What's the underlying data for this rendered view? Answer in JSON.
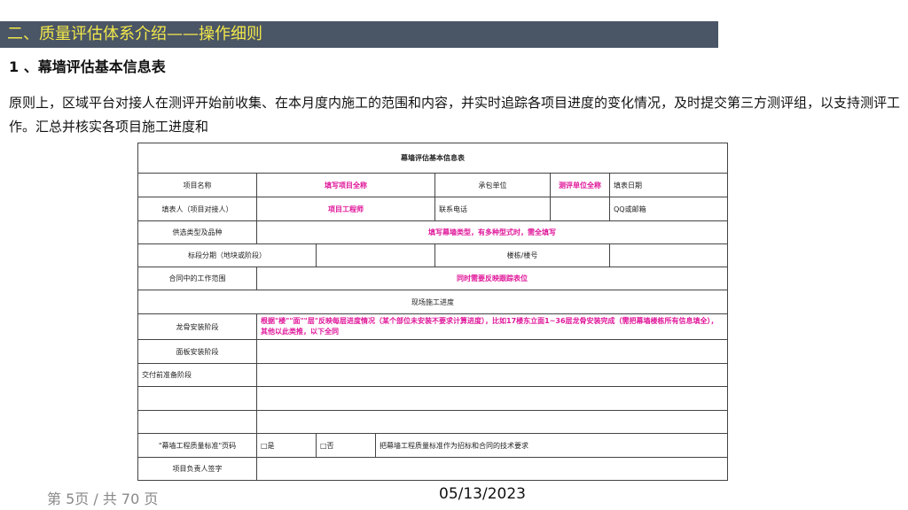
{
  "banner": "二、质量评估体系介绍——操作细则",
  "subtitle": "1 、幕墙评估基本信息表",
  "paragraph": "原则上，区域平台对接人在测评开始前收集、在本月度内施工的范围和内容，并实时追踪各项目进度的变化情况，及时提交第三方测评组，以支持测评工作。汇总并核实各项目施工进度和",
  "table": {
    "title": "幕墙评估基本信息表",
    "project_name_label": "项目名称",
    "project_name_value": "填写项目全称",
    "contractor_label": "承包单位",
    "contractor_value": "测评单位全称",
    "fill_date_label": "填表日期",
    "filler_label": "填表人（项目对接人）",
    "filler_value": "项目工程师",
    "phone_label": "联系电话",
    "qq_label": "QQ或邮箱",
    "curtain_type_label": "供选类型及品种",
    "curtain_type_value": "填写幕墙类型，有多种型式时，需全填写",
    "stage_label": "标段分期（地块或阶段）",
    "bldg_no_label": "楼栋/楼号",
    "contract_scope_label": "合同中的工作范围",
    "contract_scope_value": "同时需要反映跟踪表位",
    "current_progress_label": "现场施工进度",
    "keel_install_label": "龙骨安装阶段",
    "keel_install_value": "根据\"楼\"\"面\"\"层\"反映每层进度情况（某个部位未安装不要求计算进度），比如17楼东立面1~36层龙骨安装完成（需把幕墙楼栋所有信息填全），其他以此类推，以下全同",
    "panel_install_label": "面板安装阶段",
    "handover_label": "交付前准备阶段",
    "standard_label": "\"幕墙工程质量标准\"页码",
    "option_yes": "□是",
    "option_no": "□否",
    "standard_note": "把幕墙工程质量标准作为招标和合同的技术要求",
    "pm_sign_label": "项目负责人签字"
  },
  "footer": {
    "page": "第 5页 / 共 70 页",
    "date": "05/13/2023"
  }
}
